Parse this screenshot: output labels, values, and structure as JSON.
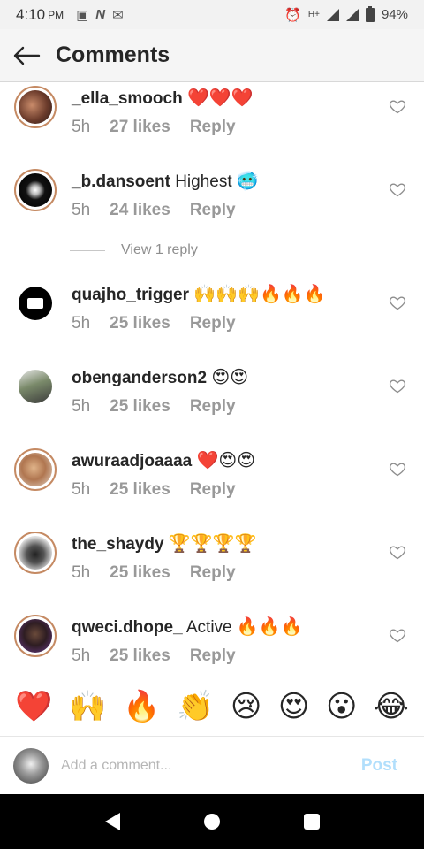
{
  "status": {
    "time": "4:10",
    "ampm": "PM",
    "battery": "94%"
  },
  "header": {
    "title": "Comments"
  },
  "comments": [
    {
      "username": "_ella_smooch",
      "text": "",
      "emoji": "❤️❤️❤️",
      "time": "5h",
      "likes": "27 likes",
      "reply": "Reply"
    },
    {
      "username": "_b.dansoent",
      "text": "Highest",
      "emoji": "🥶",
      "time": "5h",
      "likes": "24 likes",
      "reply": "Reply"
    },
    {
      "username": "quajho_trigger",
      "text": "",
      "emoji": "🙌🙌🙌🔥🔥🔥",
      "time": "5h",
      "likes": "25 likes",
      "reply": "Reply"
    },
    {
      "username": "obenganderson2",
      "text": "",
      "emoji": "😍😍",
      "time": "5h",
      "likes": "25 likes",
      "reply": "Reply"
    },
    {
      "username": "awuraadjoaaaa",
      "text": "",
      "emoji": "❤️😍😍",
      "time": "5h",
      "likes": "25 likes",
      "reply": "Reply"
    },
    {
      "username": "the_shaydy",
      "text": "",
      "emoji": "🏆🏆🏆🏆",
      "time": "5h",
      "likes": "25 likes",
      "reply": "Reply"
    },
    {
      "username": "qweci.dhope_",
      "text": "Active",
      "emoji": "🔥🔥🔥",
      "time": "5h",
      "likes": "25 likes",
      "reply": "Reply"
    }
  ],
  "view_replies": "View 1 reply",
  "emoji_bar": [
    "❤️",
    "🙌",
    "🔥",
    "👏",
    "😢",
    "😍",
    "😮",
    "😂"
  ],
  "add_comment": {
    "placeholder": "Add a comment...",
    "post_label": "Post"
  },
  "colors": {
    "post_disabled": "#b2dffc",
    "story_ring": "#c58a63",
    "meta_gray": "#8e8e8e"
  }
}
